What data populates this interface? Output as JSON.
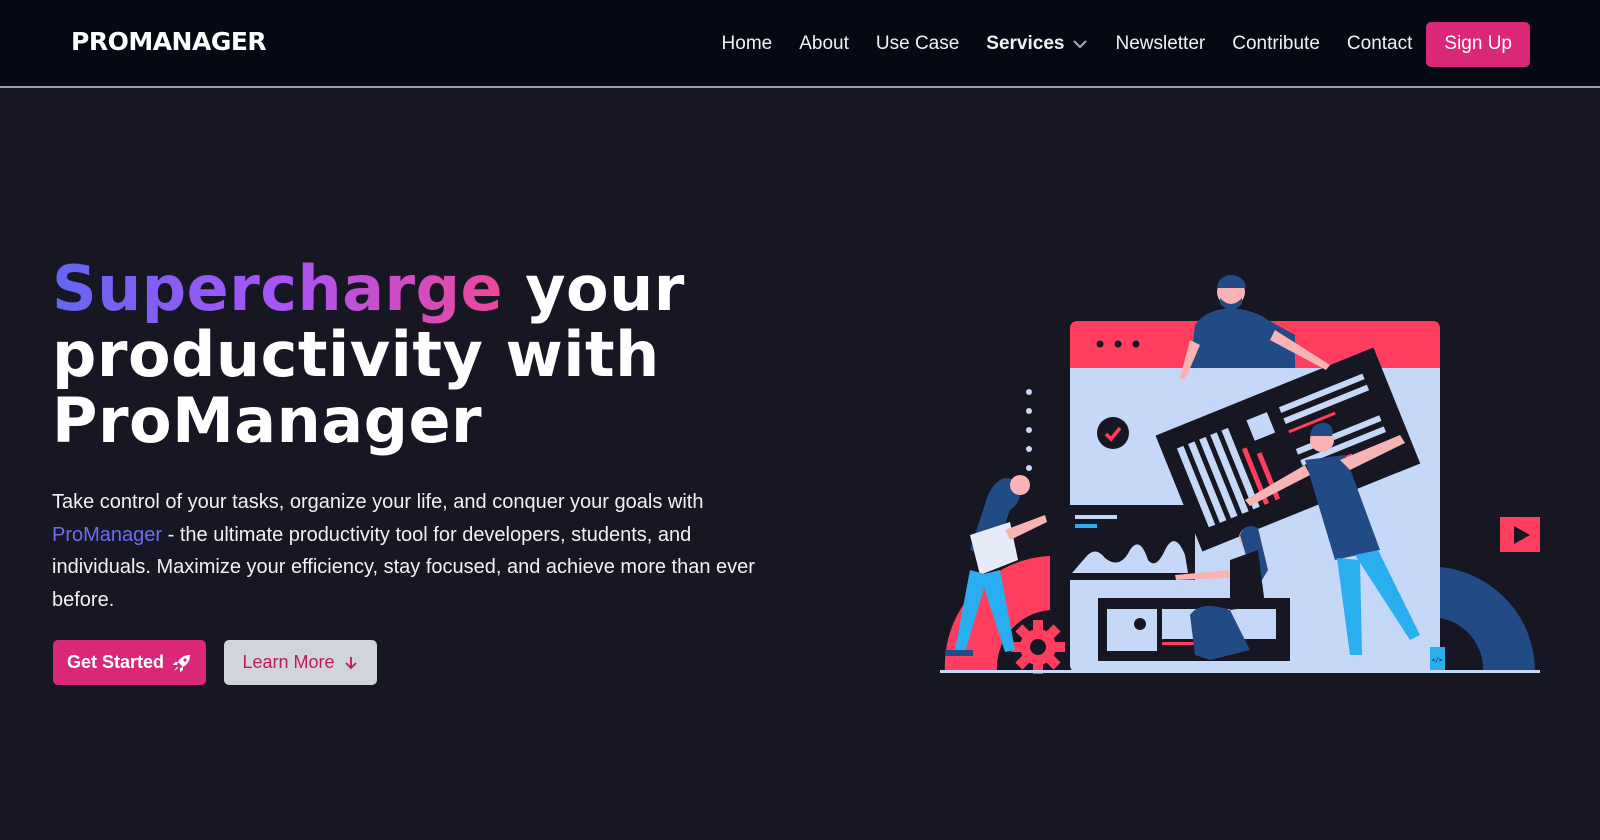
{
  "header": {
    "brand": "PROMANAGER",
    "nav": [
      {
        "label": "Home"
      },
      {
        "label": "About"
      },
      {
        "label": "Use Case"
      },
      {
        "label": "Services",
        "has_dropdown": true
      },
      {
        "label": "Newsletter"
      },
      {
        "label": "Contribute"
      },
      {
        "label": "Contact"
      }
    ],
    "signup_label": "Sign Up",
    "dropdown_icon": "chevron-down-icon"
  },
  "hero": {
    "title_highlight": "Supercharge",
    "title_rest_line1": " your",
    "title_line2": "productivity with",
    "title_line3": "ProManager",
    "desc_part1": "Take control of your tasks, organize your life, and conquer your goals with ",
    "desc_link": "ProManager",
    "desc_part2": " - the ultimate productivity tool for developers, students, and individuals. Maximize your efficiency, stay focused, and achieve more than ever before.",
    "primary_button": {
      "label": "Get Started",
      "icon": "rocket-icon"
    },
    "secondary_button": {
      "label": "Learn More",
      "icon": "arrow-down-icon"
    },
    "illustration": "team-building-dashboard-illustration"
  },
  "colors": {
    "nav_bg": "#050914",
    "page_bg": "#171723",
    "accent_pink": "#db2777",
    "secondary_btn_bg": "#d1d5db",
    "secondary_btn_text": "#be185d",
    "link_purple": "#6d6df3",
    "gradient": [
      "#6366f1",
      "#a855f7",
      "#ec4899"
    ],
    "illus_red": "#ff3e5f",
    "illus_light": "#c6d8f7",
    "illus_navy": "#224a85",
    "illus_sky": "#2aaef0"
  }
}
